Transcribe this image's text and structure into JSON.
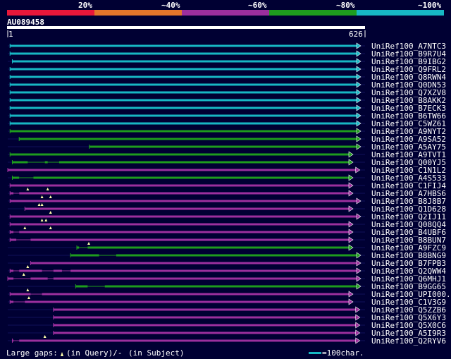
{
  "scale": {
    "labels": [
      "20%",
      "~40%",
      "~60%",
      "~80%",
      "~100%"
    ],
    "colors": [
      "#e8173a",
      "#e3762b",
      "#9c2f9e",
      "#1e9c1e",
      "#17b7c4"
    ]
  },
  "query": {
    "id": "AU089458",
    "start_label": "1",
    "end_label": "626",
    "length": 626
  },
  "hits": [
    {
      "name": "UniRef100_A7NTC3",
      "color": "#17b7c4",
      "qs": 4,
      "qe": 631,
      "gaps": []
    },
    {
      "name": "UniRef100_B9R7U4",
      "color": "#17b7c4",
      "qs": 4,
      "qe": 631,
      "gaps": []
    },
    {
      "name": "UniRef100_B9IBG2",
      "color": "#17b7c4",
      "qs": 8,
      "qe": 631,
      "gaps": []
    },
    {
      "name": "UniRef100_Q9FRL2",
      "color": "#17b7c4",
      "qs": 4,
      "qe": 631,
      "gaps": []
    },
    {
      "name": "UniRef100_Q8RWN4",
      "color": "#17b7c4",
      "qs": 4,
      "qe": 631,
      "gaps": []
    },
    {
      "name": "UniRef100_Q0DN53",
      "color": "#17b7c4",
      "qs": 4,
      "qe": 631,
      "gaps": []
    },
    {
      "name": "UniRef100_Q7XZV8",
      "color": "#17b7c4",
      "qs": 4,
      "qe": 631,
      "gaps": []
    },
    {
      "name": "UniRef100_B8AKK2",
      "color": "#17b7c4",
      "qs": 4,
      "qe": 631,
      "gaps": []
    },
    {
      "name": "UniRef100_B7ECK3",
      "color": "#17b7c4",
      "qs": 4,
      "qe": 631,
      "gaps": []
    },
    {
      "name": "UniRef100_B6TW66",
      "color": "#17b7c4",
      "qs": 4,
      "qe": 631,
      "gaps": []
    },
    {
      "name": "UniRef100_C5WZ61",
      "color": "#17b7c4",
      "qs": 4,
      "qe": 631,
      "gaps": []
    },
    {
      "name": "UniRef100_A9NYT2",
      "color": "#1e9c1e",
      "qs": 4,
      "qe": 631,
      "gaps": []
    },
    {
      "name": "UniRef100_A9SA52",
      "color": "#1e9c1e",
      "qs": 20,
      "qe": 631,
      "gaps": []
    },
    {
      "name": "UniRef100_A5AY75",
      "color": "#1e9c1e",
      "qs": 143,
      "qe": 631,
      "gaps": []
    },
    {
      "name": "UniRef100_A9TVT1",
      "color": "#1e9c1e",
      "qs": 4,
      "qe": 605,
      "gaps": []
    },
    {
      "name": "UniRef100_Q00YJ5",
      "color": "#1e9c1e",
      "qs": 8,
      "qe": 605,
      "gaps": [
        [
          35,
          65
        ],
        [
          70,
          90
        ]
      ]
    },
    {
      "name": "UniRef100_C1N1L2",
      "color": "#9c2f9e",
      "qs": 0,
      "qe": 617,
      "gaps": []
    },
    {
      "name": "UniRef100_A4S533",
      "color": "#1e9c1e",
      "qs": 8,
      "qe": 605,
      "gaps": [
        [
          20,
          45
        ]
      ]
    },
    {
      "name": "UniRef100_C1FIJ4",
      "color": "#9c2f9e",
      "qs": 4,
      "qe": 605,
      "gaps": []
    },
    {
      "name": "UniRef100_A7HBS6",
      "color": "#9c2f9e",
      "qs": 4,
      "qe": 605,
      "gaps": [
        [
          10,
          20
        ]
      ],
      "inserts": [
        35,
        70
      ]
    },
    {
      "name": "UniRef100_B8J8B7",
      "color": "#9c2f9e",
      "qs": 4,
      "qe": 631,
      "gaps": [],
      "inserts": [
        60,
        75
      ]
    },
    {
      "name": "UniRef100_Q1D628",
      "color": "#9c2f9e",
      "qs": 30,
      "qe": 605,
      "gaps": [],
      "inserts": [
        55,
        60
      ]
    },
    {
      "name": "UniRef100_Q2IJ11",
      "color": "#9c2f9e",
      "qs": 4,
      "qe": 631,
      "gaps": [],
      "inserts": [
        75
      ]
    },
    {
      "name": "UniRef100_Q08QQ4",
      "color": "#9c2f9e",
      "qs": 4,
      "qe": 605,
      "gaps": [],
      "inserts": [
        60,
        67
      ]
    },
    {
      "name": "UniRef100_B4UBF6",
      "color": "#9c2f9e",
      "qs": 4,
      "qe": 605,
      "gaps": [
        [
          10,
          20
        ]
      ],
      "inserts": [
        30,
        75
      ]
    },
    {
      "name": "UniRef100_B8BUN7",
      "color": "#9c2f9e",
      "qs": 4,
      "qe": 605,
      "gaps": [
        [
          15,
          40
        ]
      ]
    },
    {
      "name": "UniRef100_A9FZC9",
      "color": "#1e9c1e",
      "qs": 121,
      "qe": 605,
      "gaps": [
        [
          125,
          140
        ]
      ],
      "inserts": [
        142
      ]
    },
    {
      "name": "UniRef100_B8BNG9",
      "color": "#1e9c1e",
      "qs": 110,
      "qe": 631,
      "gaps": [
        [
          160,
          190
        ]
      ]
    },
    {
      "name": "UniRef100_B7FPB3",
      "color": "#9c2f9e",
      "qs": 40,
      "qe": 631,
      "gaps": []
    },
    {
      "name": "UniRef100_Q2QWW4",
      "color": "#9c2f9e",
      "qs": 4,
      "qe": 631,
      "gaps": [
        [
          10,
          20
        ],
        [
          60,
          80
        ],
        [
          95,
          110
        ]
      ],
      "inserts": [
        35
      ]
    },
    {
      "name": "UniRef100_Q6MHJ1",
      "color": "#9c2f9e",
      "qs": 0,
      "qe": 631,
      "gaps": [
        [
          10,
          40
        ],
        [
          70,
          80
        ]
      ],
      "inserts": [
        28
      ]
    },
    {
      "name": "UniRef100_B9GG65",
      "color": "#1e9c1e",
      "qs": 119,
      "qe": 631,
      "gaps": [
        [
          140,
          170
        ]
      ]
    },
    {
      "name": "UniRef100_UPI000...",
      "color": "#9c2f9e",
      "qs": 4,
      "qe": 605,
      "gaps": [
        [
          40,
          60
        ]
      ],
      "inserts": [
        35
      ]
    },
    {
      "name": "UniRef100_C1V3G9",
      "color": "#9c2f9e",
      "qs": 4,
      "qe": 605,
      "gaps": [
        [
          10,
          30
        ]
      ],
      "inserts": [
        37
      ]
    },
    {
      "name": "UniRef100_Q5ZZB6",
      "color": "#9c2f9e",
      "qs": 80,
      "qe": 617,
      "gaps": []
    },
    {
      "name": "UniRef100_Q5X6Y3",
      "color": "#9c2f9e",
      "qs": 80,
      "qe": 617,
      "gaps": []
    },
    {
      "name": "UniRef100_Q5X0C6",
      "color": "#9c2f9e",
      "qs": 80,
      "qe": 617,
      "gaps": []
    },
    {
      "name": "UniRef100_A5I9R3",
      "color": "#9c2f9e",
      "qs": 80,
      "qe": 617,
      "gaps": []
    },
    {
      "name": "UniRef100_Q2RYV6",
      "color": "#9c2f9e",
      "qs": 8,
      "qe": 617,
      "gaps": [
        [
          10,
          20
        ]
      ],
      "inserts": [
        65
      ]
    }
  ],
  "legend": {
    "gap_text": "Large gaps:",
    "query_gap": "(in Query)/-",
    "subject_gap": "(in Subject)",
    "scale_text": "=100char.",
    "scale_color": "#17b7c4"
  }
}
